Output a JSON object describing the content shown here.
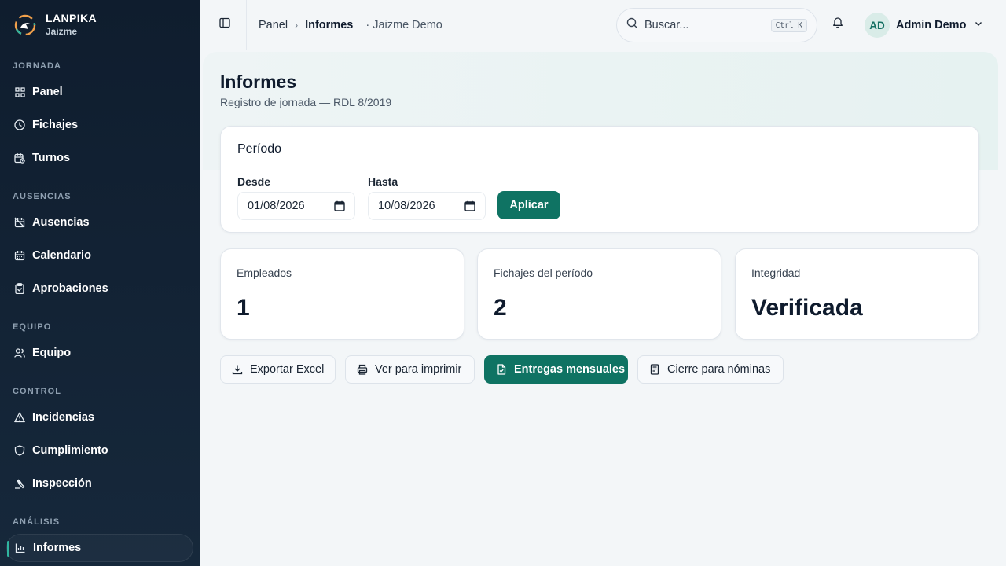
{
  "brand": {
    "name": "LANPIKA",
    "org": "Jaizme"
  },
  "sidebar": {
    "sections": [
      {
        "label": "JORNADA"
      },
      {
        "label": "AUSENCIAS"
      },
      {
        "label": "EQUIPO"
      },
      {
        "label": "CONTROL"
      },
      {
        "label": "ANÁLISIS"
      }
    ],
    "items": [
      {
        "label": "Panel",
        "icon": "grid-icon"
      },
      {
        "label": "Fichajes",
        "icon": "clock-icon"
      },
      {
        "label": "Turnos",
        "icon": "calendar-clock-icon"
      },
      {
        "label": "Ausencias",
        "icon": "calendar-off-icon"
      },
      {
        "label": "Calendario",
        "icon": "calendar-icon"
      },
      {
        "label": "Aprobaciones",
        "icon": "clipboard-check-icon"
      },
      {
        "label": "Equipo",
        "icon": "users-icon"
      },
      {
        "label": "Incidencias",
        "icon": "warning-icon"
      },
      {
        "label": "Cumplimiento",
        "icon": "shield-icon"
      },
      {
        "label": "Inspección",
        "icon": "gavel-icon"
      },
      {
        "label": "Informes",
        "icon": "bar-chart-icon",
        "active": true
      }
    ]
  },
  "header": {
    "breadcrumb": {
      "root": "Panel",
      "current": "Informes",
      "org": "Jaizme Demo"
    },
    "search": {
      "placeholder": "Buscar...",
      "shortcut": "Ctrl K"
    },
    "user": {
      "initials": "AD",
      "name": "Admin Demo"
    }
  },
  "page": {
    "title": "Informes",
    "subtitle": "Registro de jornada — RDL 8/2019"
  },
  "period": {
    "title": "Período",
    "from_label": "Desde",
    "from_value": "01/08/2026",
    "to_label": "Hasta",
    "to_value": "10/08/2026",
    "apply_label": "Aplicar"
  },
  "stats": [
    {
      "label": "Empleados",
      "value": "1"
    },
    {
      "label": "Fichajes del período",
      "value": "2"
    },
    {
      "label": "Integridad",
      "value": "Verificada"
    }
  ],
  "actions": [
    {
      "label": "Exportar Excel",
      "icon": "download-icon"
    },
    {
      "label": "Ver para imprimir",
      "icon": "printer-icon"
    },
    {
      "label": "Entregas mensuales",
      "icon": "file-check-icon",
      "primary": true
    },
    {
      "label": "Cierre para nóminas",
      "icon": "receipt-icon"
    }
  ],
  "colors": {
    "accent": "#0f7363",
    "sidebar_bg": "#0f1d2e",
    "active_marker": "#2fb5a0"
  }
}
